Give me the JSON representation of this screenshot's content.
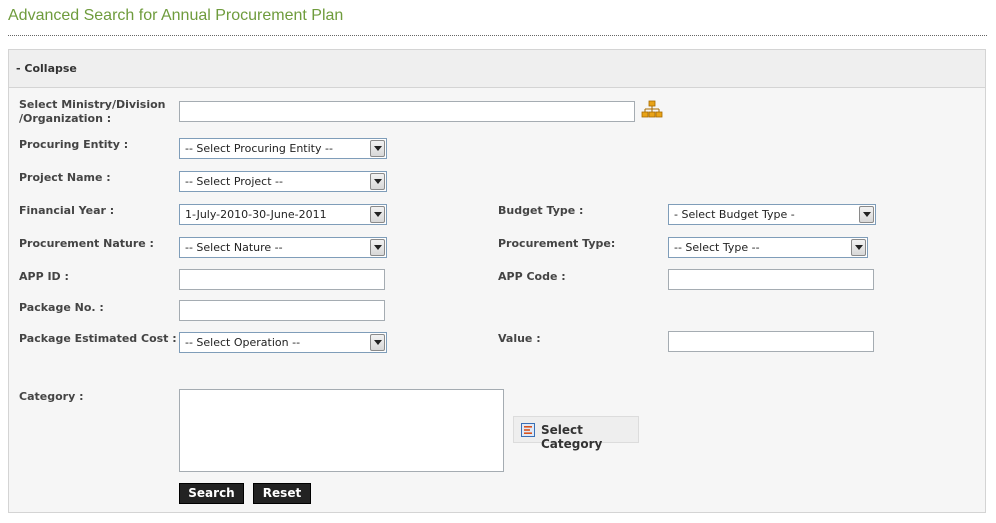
{
  "page": {
    "title": "Advanced Search for Annual Procurement Plan"
  },
  "panel": {
    "collapse_label": "- Collapse"
  },
  "form": {
    "ministry": {
      "label": "Select Ministry/Division /Organization :",
      "value": ""
    },
    "procuring_entity": {
      "label": "Procuring Entity :",
      "selected": "-- Select Procuring Entity --"
    },
    "project_name": {
      "label": "Project Name :",
      "selected": "-- Select Project --"
    },
    "financial_year": {
      "label": "Financial Year :",
      "selected": "1-July-2010-30-June-2011"
    },
    "budget_type": {
      "label": "Budget Type :",
      "selected": "- Select Budget Type -"
    },
    "procurement_nature": {
      "label": "Procurement Nature :",
      "selected": "-- Select Nature --"
    },
    "procurement_type": {
      "label": "Procurement Type:",
      "selected": "-- Select Type --"
    },
    "app_id": {
      "label": "APP ID :",
      "value": ""
    },
    "app_code": {
      "label": "APP Code :",
      "value": ""
    },
    "package_no": {
      "label": "Package No. :",
      "value": ""
    },
    "package_cost": {
      "label": "Package Estimated Cost :",
      "selected": "-- Select Operation --"
    },
    "value": {
      "label": "Value :",
      "value": ""
    },
    "category": {
      "label": "Category :",
      "value": ""
    },
    "select_category_label": "Select Category"
  },
  "buttons": {
    "search": "Search",
    "reset": "Reset"
  },
  "colors": {
    "title": "#6f9c3d",
    "button_bg": "#222222",
    "panel_bg": "#f6f6f6"
  },
  "icons": {
    "org": "org-tree-icon",
    "category": "category-picker-icon",
    "dropdown": "chevron-down-icon"
  }
}
